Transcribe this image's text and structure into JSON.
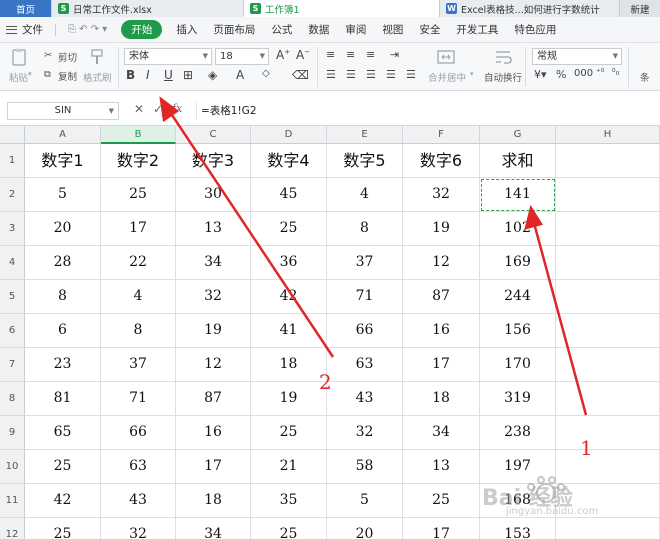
{
  "tabs": {
    "home": "首页",
    "file1": "日常工作文件.xlsx",
    "active": "工作簿1",
    "web": "Excel表格技...如何进行字数统计",
    "new": "新建"
  },
  "menu": {
    "file": "文件",
    "items": [
      "插入",
      "页面布局",
      "公式",
      "数据",
      "审阅",
      "视图",
      "安全",
      "开发工具",
      "特色应用"
    ],
    "start": "开始"
  },
  "ribbon": {
    "paste": "粘贴",
    "cut": "剪切",
    "copy": "复制",
    "format_painter": "格式刷",
    "font_name": "宋体",
    "font_size": "18",
    "merge_center": "合并居中",
    "wrap_text": "自动换行",
    "number_format": "常规",
    "extra": "条"
  },
  "formula_bar": {
    "name_box": "SIN",
    "cancel": "✕",
    "confirm": "✓",
    "fx": "fx",
    "formula": "=表格1!G2"
  },
  "grid": {
    "columns": [
      "A",
      "B",
      "C",
      "D",
      "E",
      "F",
      "G",
      "H"
    ],
    "rows": [
      "1",
      "2",
      "3",
      "4",
      "5",
      "6",
      "7",
      "8",
      "9",
      "10",
      "11",
      "12"
    ],
    "header": [
      "数字1",
      "数字2",
      "数字3",
      "数字4",
      "数字5",
      "数字6",
      "求和"
    ],
    "data": [
      [
        "5",
        "25",
        "30",
        "45",
        "4",
        "32",
        "141"
      ],
      [
        "20",
        "17",
        "13",
        "25",
        "8",
        "19",
        "102"
      ],
      [
        "28",
        "22",
        "34",
        "36",
        "37",
        "12",
        "169"
      ],
      [
        "8",
        "4",
        "32",
        "42",
        "71",
        "87",
        "244"
      ],
      [
        "6",
        "8",
        "19",
        "41",
        "66",
        "16",
        "156"
      ],
      [
        "23",
        "37",
        "12",
        "18",
        "63",
        "17",
        "170"
      ],
      [
        "81",
        "71",
        "87",
        "19",
        "43",
        "18",
        "319"
      ],
      [
        "65",
        "66",
        "16",
        "25",
        "32",
        "34",
        "238"
      ],
      [
        "25",
        "63",
        "17",
        "21",
        "58",
        "13",
        "197"
      ],
      [
        "42",
        "43",
        "18",
        "35",
        "5",
        "25",
        "168"
      ],
      [
        "25",
        "32",
        "34",
        "25",
        "20",
        "17",
        "153"
      ]
    ]
  },
  "annotations": {
    "label1": "1",
    "label2": "2",
    "color": "#e02626"
  },
  "watermark": {
    "brand": "Bai 经验",
    "url": "jingyan.baidu.com"
  }
}
